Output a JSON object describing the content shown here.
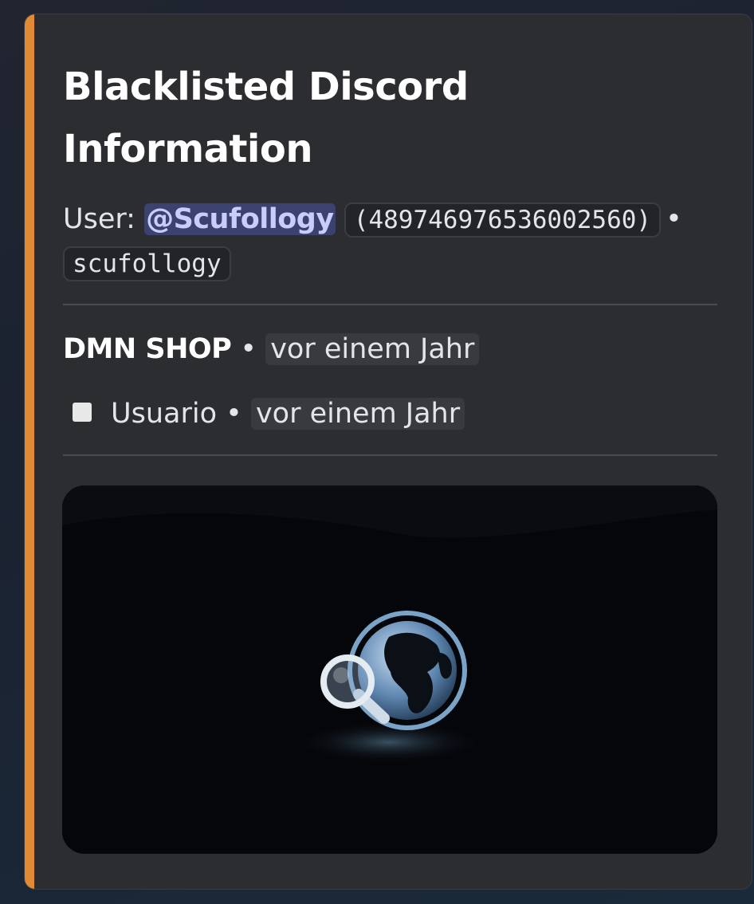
{
  "embed": {
    "accent_color": "#e08a35",
    "title": "Blacklisted Discord Information",
    "user": {
      "label": "User:",
      "mention": "@Scufollogy",
      "id": "(489746976536002560)",
      "separator": "•",
      "username": "scufollogy"
    },
    "server_row": {
      "name": "DMN SHOP",
      "separator": "•",
      "timestamp": "vor einem Jahr"
    },
    "role_row": {
      "icon": "white-square-icon",
      "role": "Usuario",
      "separator": "•",
      "timestamp": "vor einem Jahr"
    },
    "image": {
      "icon": "globe-magnifier-icon"
    }
  }
}
